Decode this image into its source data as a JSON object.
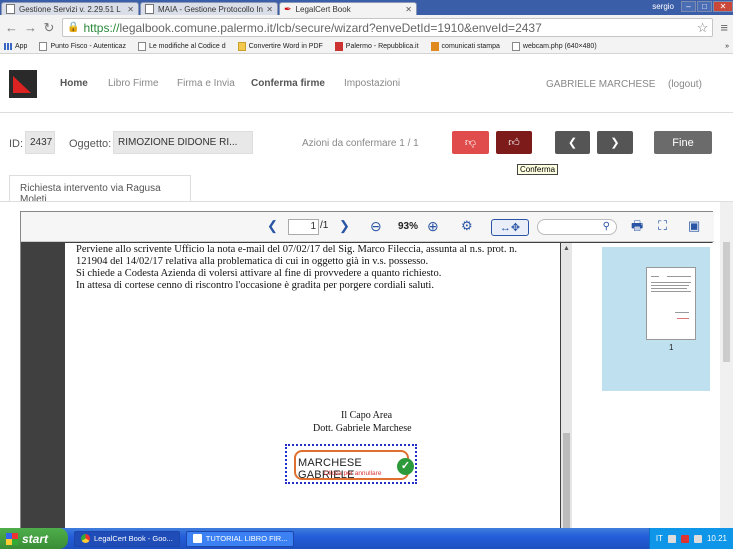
{
  "browser": {
    "tabs": [
      {
        "label": "Gestione Servizi v. 2.29.51 L",
        "active": false
      },
      {
        "label": "MAIA - Gestione Protocollo In",
        "active": false
      },
      {
        "label": "LegalCert Book",
        "active": true
      }
    ],
    "user_chip": "sergio",
    "url_scheme": "https://",
    "url_rest": "legalbook.comune.palermo.it/lcb/secure/wizard?enveDetId=1910&enveId=2437",
    "bookmarks": [
      {
        "label": "App",
        "icon": "apps-icon"
      },
      {
        "label": "Punto Fisco - Autenticaz",
        "icon": "page-icon"
      },
      {
        "label": "Le modifiche al Codice d",
        "icon": "page-icon"
      },
      {
        "label": "Convertire Word in PDF",
        "icon": "folder-icon"
      },
      {
        "label": "Palermo - Repubblica.it",
        "icon": "repubblica-icon"
      },
      {
        "label": "comunicati stampa",
        "icon": "orange-icon"
      },
      {
        "label": "webcam.php (640×480)",
        "icon": "page-icon"
      }
    ],
    "bookmarks_more": "»"
  },
  "app": {
    "menu": {
      "home": "Home",
      "libro_firme": "Libro Firme",
      "firma_invia": "Firma e Invia",
      "conferma_firme": "Conferma firme",
      "impostazioni": "Impostazioni"
    },
    "username": "GABRIELE MARCHESE",
    "logout": "(logout)"
  },
  "actions": {
    "id_label": "ID:",
    "id_value": "2437",
    "oggetto_label": "Oggetto:",
    "oggetto_value": "RIMOZIONE DIDONE RI...",
    "azioni_text": "Azioni da confermare 1 / 1",
    "fine_label": "Fine",
    "tooltip": "Conferma"
  },
  "doc_tab": "Richiesta intervento via Ragusa Moleti",
  "viewer": {
    "page_current": "1",
    "page_total": "/1",
    "zoom": "93%",
    "thumb_number": "1"
  },
  "document": {
    "lines": [
      "Perviene allo scrivente Ufficio la nota e-mail del 07/02/17 del Sig. Marco Fileccia, assunta al n.s. prot. n.",
      "121904 del 14/02/17 relativa alla problematica di cui in oggetto già in v.s. possesso.",
      "Si chiede a Codesta Azienda di volersi attivare al fine di provvedere a quanto richiesto.",
      "In attesa di cortese cenno di riscontro l'occasione è gradita per porgere cordiali saluti."
    ],
    "signer_title": "Il Capo Area",
    "signer_name": "Dott. Gabriele Marchese",
    "signature_name": "MARCHESE GABRIELE",
    "signature_hint": "Clicca per annullare"
  },
  "taskbar": {
    "start": "start",
    "tasks": [
      {
        "label": "LegalCert Book - Goo...",
        "active": true
      },
      {
        "label": "TUTORIAL LIBRO FIR...",
        "active": false
      }
    ],
    "lang": "IT",
    "clock": "10.21"
  }
}
